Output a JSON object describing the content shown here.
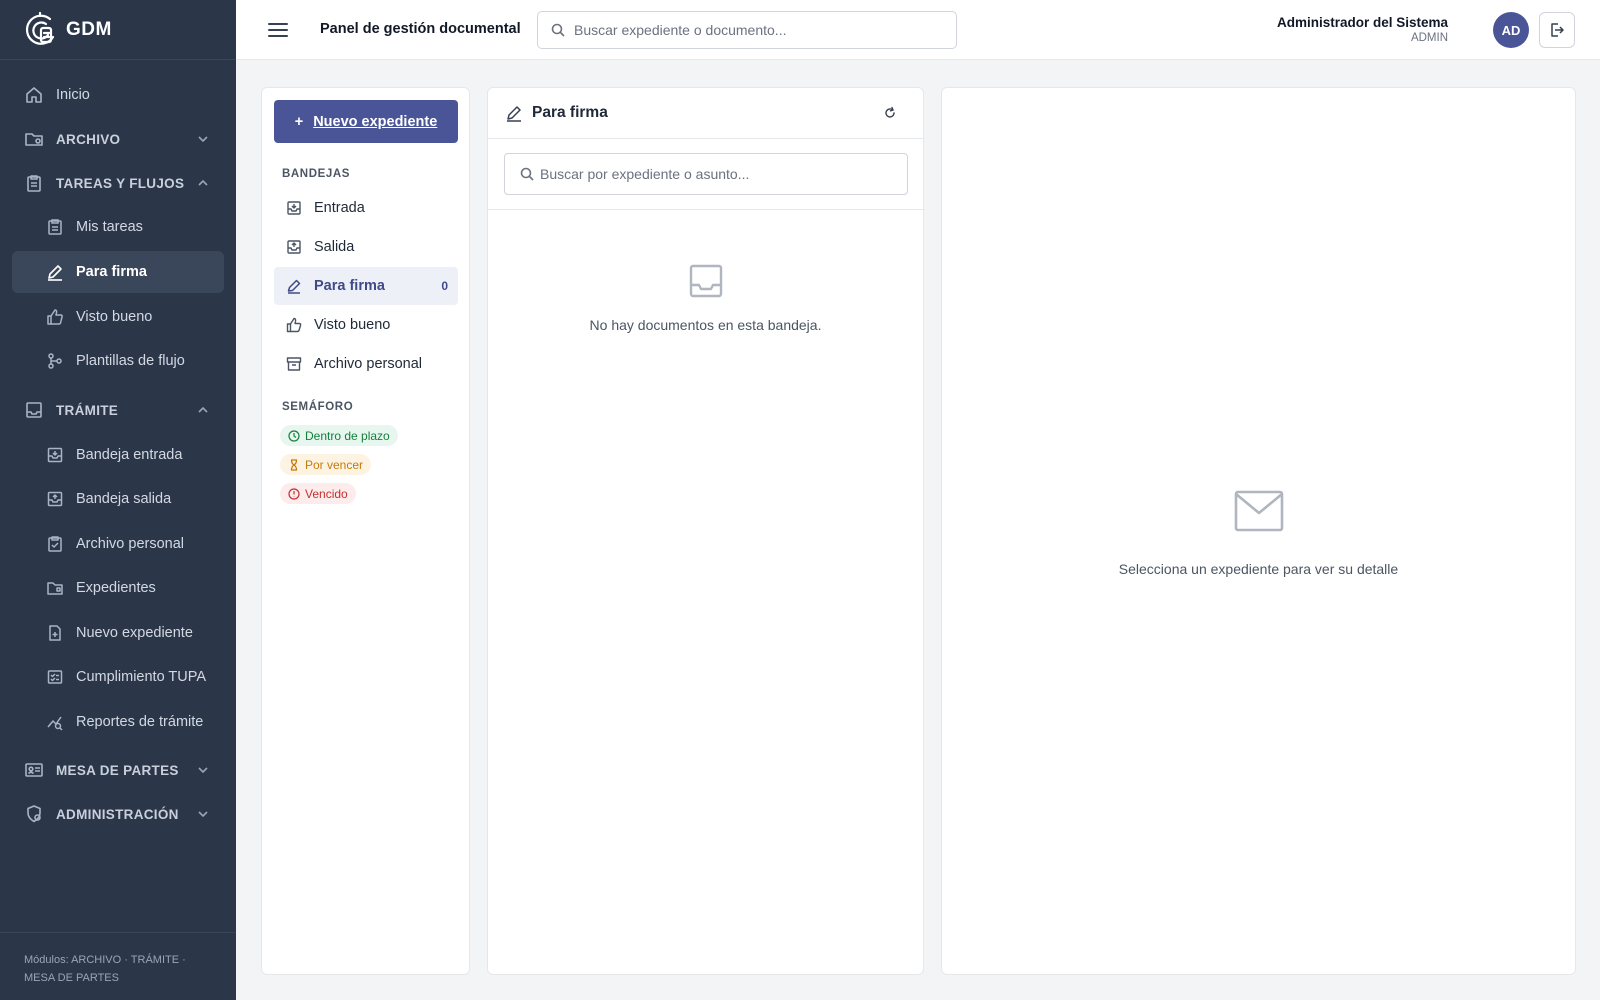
{
  "brand": {
    "name": "GDM"
  },
  "sidebar": {
    "items": [
      {
        "label": "Inicio"
      },
      {
        "label": "ARCHIVO"
      },
      {
        "label": "TAREAS Y FLUJOS"
      },
      {
        "label": "Mis tareas"
      },
      {
        "label": "Para firma"
      },
      {
        "label": "Visto bueno"
      },
      {
        "label": "Plantillas de flujo"
      },
      {
        "label": "TRÁMITE"
      },
      {
        "label": "Bandeja entrada"
      },
      {
        "label": "Bandeja salida"
      },
      {
        "label": "Archivo personal"
      },
      {
        "label": "Expedientes"
      },
      {
        "label": "Nuevo expediente"
      },
      {
        "label": "Cumplimiento TUPA"
      },
      {
        "label": "Reportes de trámite"
      },
      {
        "label": "MESA DE PARTES"
      },
      {
        "label": "ADMINISTRACIÓN"
      }
    ],
    "footer": "Módulos: ARCHIVO · TRÁMITE · MESA DE PARTES"
  },
  "header": {
    "title": "Panel de gestión documental",
    "search_placeholder": "Buscar expediente o documento...",
    "user_name": "Administrador del Sistema",
    "user_role": "ADMIN",
    "avatar_initials": "AD"
  },
  "trays": {
    "new_button": "Nuevo expediente",
    "group_bandejas": "BANDEJAS",
    "items": [
      {
        "label": "Entrada"
      },
      {
        "label": "Salida"
      },
      {
        "label": "Para firma",
        "count": "0"
      },
      {
        "label": "Visto bueno"
      },
      {
        "label": "Archivo personal"
      }
    ],
    "group_semaforo": "SEMÁFORO",
    "badges": [
      {
        "label": "Dentro de plazo",
        "color": "#15803d"
      },
      {
        "label": "Por vencer",
        "color": "#c67a07"
      },
      {
        "label": "Vencido",
        "color": "#c53030"
      }
    ]
  },
  "list": {
    "title": "Para firma",
    "search_placeholder": "Buscar por expediente o asunto...",
    "empty_text": "No hay documentos en esta bandeja."
  },
  "detail": {
    "empty_text": "Selecciona un expediente para ver su detalle"
  },
  "colors": {
    "sidebar_bg": "#2b3649",
    "accent": "#4a5597"
  }
}
